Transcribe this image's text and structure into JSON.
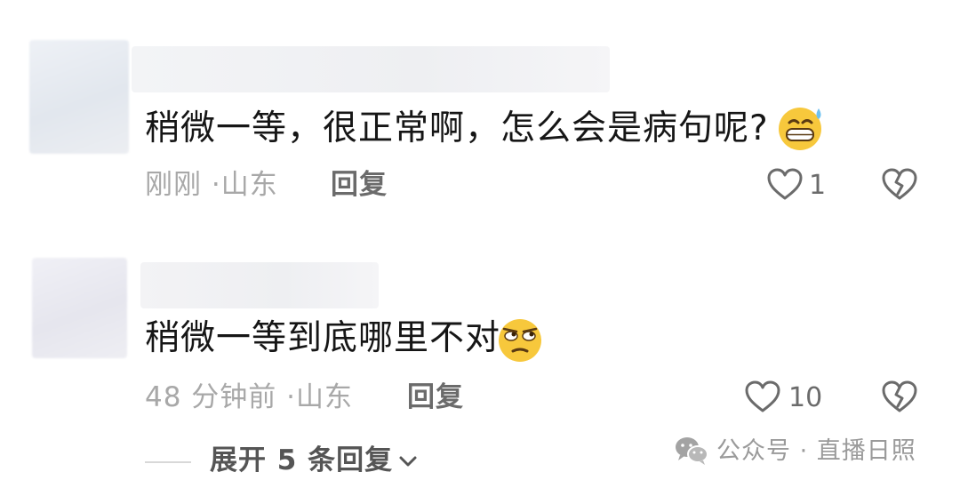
{
  "comments": [
    {
      "text": "稍微一等，很正常啊，怎么会是病句呢?",
      "emoji": "grinning-sweat-emoji",
      "time": "刚刚",
      "separator": "·",
      "location": "山东",
      "reply_label": "回复",
      "likes": "1"
    },
    {
      "text": "稍微一等到底哪里不对",
      "emoji": "unamused-emoji",
      "time": "48 分钟前",
      "separator": "·",
      "location": "山东",
      "reply_label": "回复",
      "likes": "10"
    }
  ],
  "expand": {
    "label": "展开 5 条回复"
  },
  "watermark": {
    "icon": "wechat-icon",
    "text": "公众号 · 直播日照"
  },
  "colors": {
    "text": "#161616",
    "meta": "#a8a8a8",
    "action": "#6b6b6b",
    "emoji_face": "#f7c83c"
  }
}
